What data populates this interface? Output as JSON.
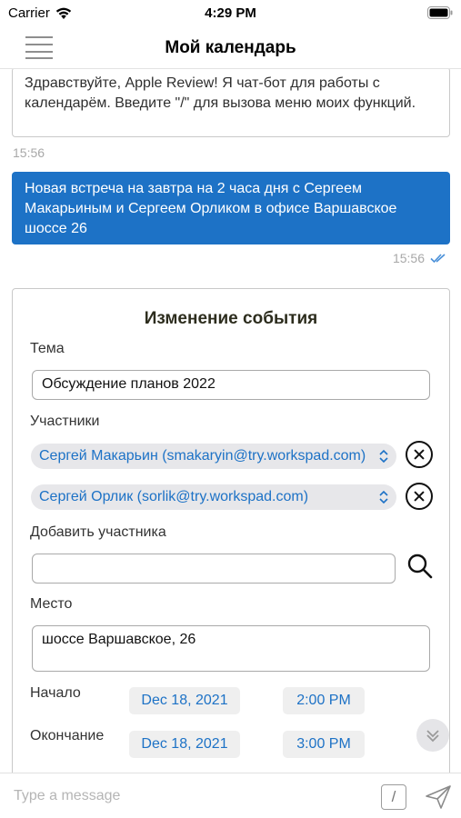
{
  "status_bar": {
    "carrier": "Carrier",
    "time": "4:29 PM"
  },
  "nav": {
    "title": "Мой календарь"
  },
  "chat": {
    "bot_message": {
      "text": "Здравствуйте, Apple Review! Я чат-бот для работы с календарём. Введите \"/\" для вызова меню моих функций.",
      "time": "15:56"
    },
    "user_message": {
      "text": "Новая встреча на завтра на 2 часа дня с Сергеем Макарьиным и Сергеем Орликом в офисе Варшавское шоссе 26",
      "time": "15:56"
    }
  },
  "form": {
    "title": "Изменение события",
    "topic_label": "Тема",
    "topic_value": "Обсуждение планов 2022",
    "participants_label": "Участники",
    "participants": [
      "Сергей Макарьин (smakaryin@try.workspad.com)",
      "Сергей Орлик (sorlik@try.workspad.com)"
    ],
    "add_participant_label": "Добавить участника",
    "add_participant_value": "",
    "place_label": "Место",
    "place_value": "шоссе Варшавское, 26",
    "start_label": "Начало",
    "start_date": "Dec 18, 2021",
    "start_time": "2:00 PM",
    "end_label": "Окончание",
    "end_date": "Dec 18, 2021",
    "end_time": "3:00 PM"
  },
  "input_bar": {
    "placeholder": "Type a message",
    "slash_label": "/"
  },
  "colors": {
    "accent": "#1d72c6",
    "bubble_user": "#1d72c6",
    "read_check": "#4a90d9"
  }
}
